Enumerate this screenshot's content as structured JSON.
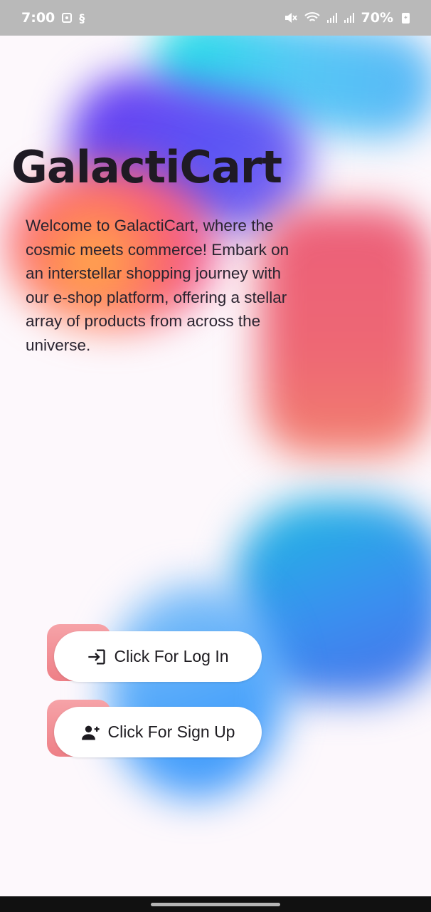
{
  "status_bar": {
    "time": "7:00",
    "battery": "70%",
    "icons": [
      "notification-icon",
      "sim-icon",
      "mute-icon",
      "wifi-icon",
      "signal-icon",
      "signal-icon",
      "battery-charging-icon"
    ]
  },
  "app": {
    "title": "GalactiCart",
    "description": "Welcome to GalactiCart, where the cosmic meets commerce! Embark on an interstellar shopping journey with our e-shop platform, offering a stellar array of products from across the universe."
  },
  "buttons": {
    "login": {
      "label": "Click For Log In",
      "icon": "login-icon"
    },
    "signup": {
      "label": "Click For Sign Up",
      "icon": "person-add-icon"
    }
  },
  "colors": {
    "accent": "#ee7f86",
    "background": "#fdf8fc",
    "text": "#1f1a24"
  }
}
